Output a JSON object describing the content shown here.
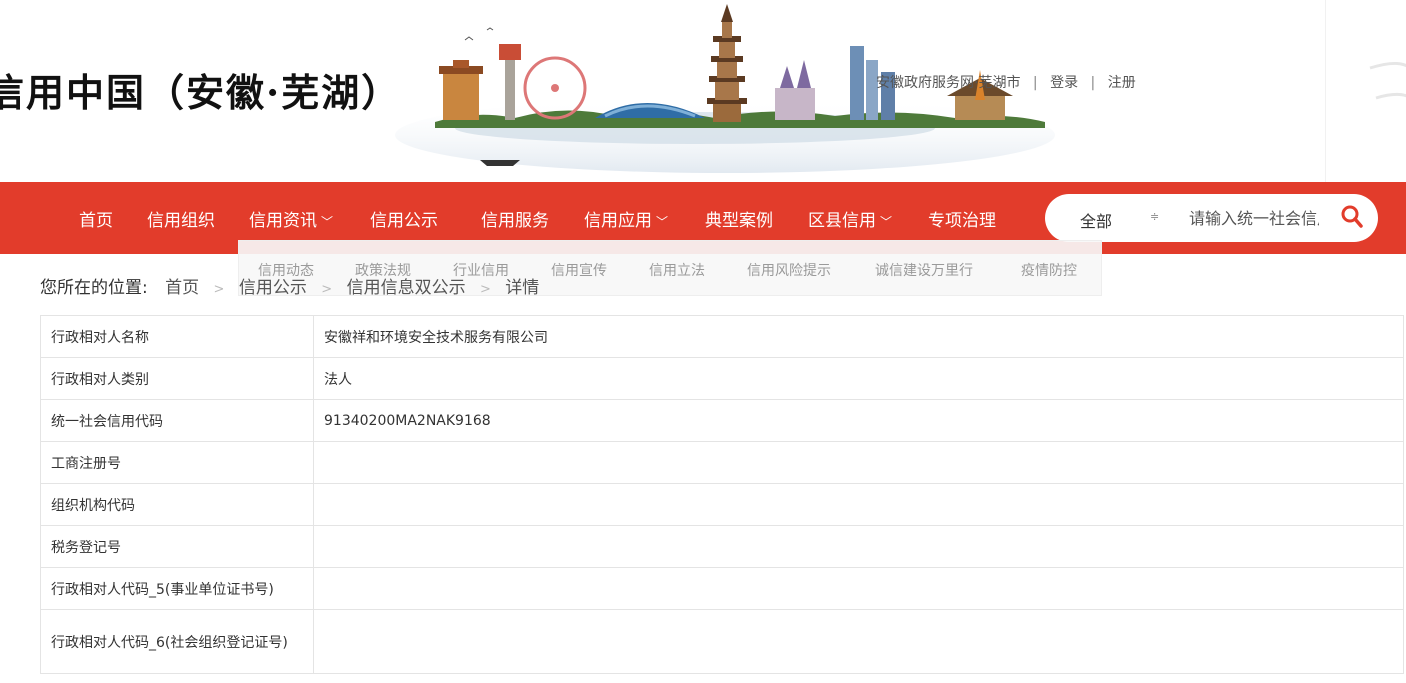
{
  "header": {
    "site_title": "信用中国（安徽·芜湖）",
    "top_links": {
      "gov_service": "安徽政府服务网·芜湖市",
      "separator": "|",
      "login": "登录",
      "register": "注册"
    }
  },
  "nav": {
    "items": [
      {
        "label": "首页",
        "has_dropdown": false
      },
      {
        "label": "信用组织",
        "has_dropdown": false
      },
      {
        "label": "信用资讯",
        "has_dropdown": true
      },
      {
        "label": "信用公示",
        "has_dropdown": false
      },
      {
        "label": "信用服务",
        "has_dropdown": false
      },
      {
        "label": "信用应用",
        "has_dropdown": true
      },
      {
        "label": "典型案例",
        "has_dropdown": false
      },
      {
        "label": "区县信用",
        "has_dropdown": true
      },
      {
        "label": "专项治理",
        "has_dropdown": false
      }
    ],
    "dropdown_icon": "chevron-down-icon",
    "submenu": [
      "信用动态",
      "政策法规",
      "行业信用",
      "信用宣传",
      "信用立法",
      "信用风险提示",
      "诚信建设万里行",
      "疫情防控"
    ]
  },
  "search": {
    "scope": "全部",
    "scope_icon": "sort-arrows-icon",
    "placeholder": "请输入统一社会信用代码",
    "icon": "search-icon"
  },
  "breadcrumb": {
    "label": "您所在的位置:",
    "items": [
      "首页",
      "信用公示",
      "信用信息双公示",
      "详情"
    ],
    "separator": ">"
  },
  "detail": {
    "rows": [
      {
        "key": "行政相对人名称",
        "value": "安徽祥和环境安全技术服务有限公司"
      },
      {
        "key": "行政相对人类别",
        "value": "法人"
      },
      {
        "key": "统一社会信用代码",
        "value": "91340200MA2NAK9168"
      },
      {
        "key": "工商注册号",
        "value": ""
      },
      {
        "key": "组织机构代码",
        "value": ""
      },
      {
        "key": "税务登记号",
        "value": ""
      },
      {
        "key": "行政相对人代码_5(事业单位证书号)",
        "value": ""
      },
      {
        "key": "行政相对人代码_6(社会组织登记证号)",
        "value": ""
      }
    ]
  },
  "colors": {
    "nav_red": "#e23c2b",
    "search_icon_red": "#e23c2b"
  }
}
